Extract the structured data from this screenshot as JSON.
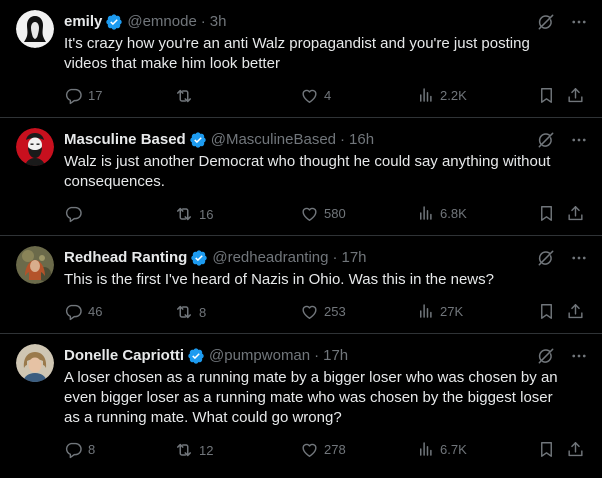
{
  "tweets": [
    {
      "name": "emily",
      "handle": "@emnode",
      "time": "3h",
      "text": "It's crazy how you're an anti Walz propagandist and you're just posting videos that make him look better",
      "replies": "17",
      "retweets": "",
      "likes": "4",
      "views": "2.2K",
      "avatar": "emily-avatar"
    },
    {
      "name": "Masculine Based",
      "handle": "@MasculineBased",
      "time": "16h",
      "text": "Walz is just another Democrat who thought he could say anything without consequences.",
      "replies": "",
      "retweets": "16",
      "likes": "580",
      "views": "6.8K",
      "avatar": "masculine-based-avatar"
    },
    {
      "name": "Redhead Ranting",
      "handle": "@redheadranting",
      "time": "17h",
      "text": "This is the first I've heard of Nazis in Ohio. Was this in the news?",
      "replies": "46",
      "retweets": "8",
      "likes": "253",
      "views": "27K",
      "avatar": "redhead-ranting-avatar"
    },
    {
      "name": "Donelle Capriotti",
      "handle": "@pumpwoman",
      "time": "17h",
      "text": "A loser chosen as a running mate by a bigger loser who was chosen by an even bigger loser as a running mate who was chosen by the biggest loser as a running mate. What could go wrong?",
      "replies": "8",
      "retweets": "12",
      "likes": "278",
      "views": "6.7K",
      "avatar": "donelle-capriotti-avatar"
    }
  ],
  "colors": {
    "background": "#000000",
    "text": "#e7e9ea",
    "muted": "#71767b",
    "verified": "#1d9bf0",
    "divider": "#2f3336"
  },
  "icons": [
    "verified-badge-icon",
    "grok-icon",
    "more-icon",
    "reply-icon",
    "retweet-icon",
    "like-icon",
    "views-icon",
    "bookmark-icon",
    "share-icon"
  ]
}
